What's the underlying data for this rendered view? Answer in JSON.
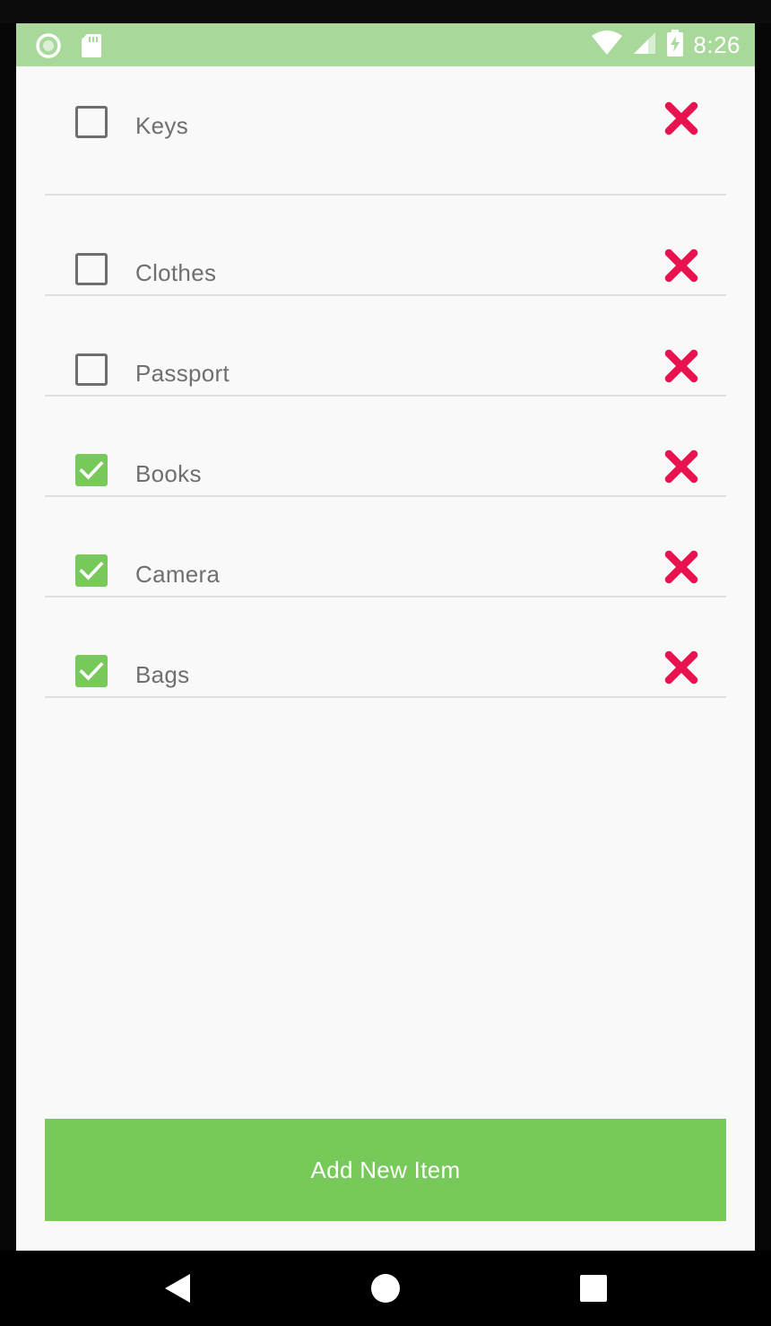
{
  "status_bar": {
    "time": "8:26",
    "icons": [
      "circle-notification-icon",
      "sd-card-icon",
      "wifi-icon",
      "signal-icon",
      "battery-charging-icon"
    ]
  },
  "items": [
    {
      "label": "Keys",
      "checked": false
    },
    {
      "label": "Clothes",
      "checked": false
    },
    {
      "label": "Passport",
      "checked": false
    },
    {
      "label": "Books",
      "checked": true
    },
    {
      "label": "Camera",
      "checked": true
    },
    {
      "label": "Bags",
      "checked": true
    }
  ],
  "add_button": {
    "label": "Add New Item"
  },
  "colors": {
    "accent": "#77c95a",
    "status_bar": "#a9d99a",
    "delete": "#e8124f",
    "text": "#6f6f6f"
  },
  "nav": {
    "icons": [
      "back-icon",
      "home-icon",
      "recents-icon"
    ]
  }
}
